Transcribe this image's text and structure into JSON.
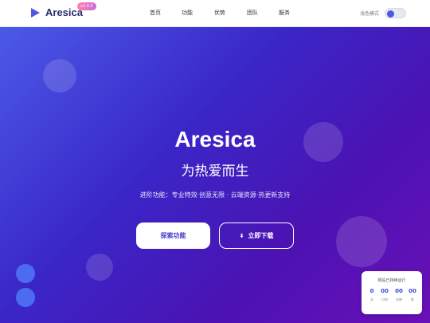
{
  "header": {
    "brand": "Aresica",
    "version_badge": "v2.0.0",
    "nav": [
      "首页",
      "功能",
      "优势",
      "团队",
      "服务"
    ],
    "theme_label": "浅色模式",
    "theme_toggle_on": true
  },
  "hero": {
    "title": "Aresica",
    "subtitle": "为热爱而生",
    "description": "进阶功能：专业特效·创意无限 · 云端资源·热更新支持",
    "primary_button": "探索功能",
    "secondary_button": "立即下载",
    "secondary_icon": "download-icon"
  },
  "countdown": {
    "title": "网站已持续运行",
    "cells": [
      {
        "value": "0",
        "unit": "天"
      },
      {
        "value": "00",
        "unit": "小时"
      },
      {
        "value": "00",
        "unit": "分钟"
      },
      {
        "value": "00",
        "unit": "秒"
      }
    ]
  },
  "colors": {
    "accent": "#4e56e6",
    "hero_start": "#4b5ae8",
    "hero_end": "#6a10b8"
  }
}
